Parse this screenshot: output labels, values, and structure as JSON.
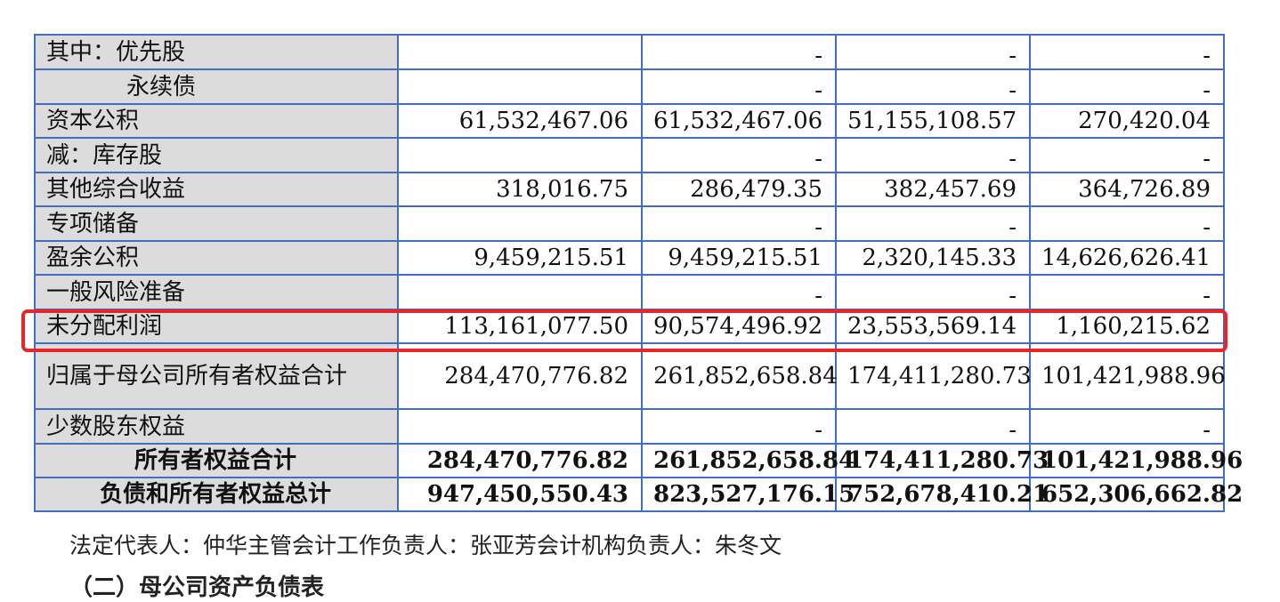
{
  "table": {
    "rows": [
      {
        "label": "其中：优先股",
        "values": [
          "",
          "-",
          "-",
          "-"
        ]
      },
      {
        "label": "永续债",
        "values": [
          "",
          "-",
          "-",
          "-"
        ]
      },
      {
        "label": "资本公积",
        "values": [
          "61,532,467.06",
          "61,532,467.06",
          "51,155,108.57",
          "270,420.04"
        ]
      },
      {
        "label": "减：库存股",
        "values": [
          "",
          "-",
          "-",
          "-"
        ]
      },
      {
        "label": "其他综合收益",
        "values": [
          "318,016.75",
          "286,479.35",
          "382,457.69",
          "364,726.89"
        ]
      },
      {
        "label": "专项储备",
        "values": [
          "",
          "-",
          "-",
          "-"
        ]
      },
      {
        "label": "盈余公积",
        "values": [
          "9,459,215.51",
          "9,459,215.51",
          "2,320,145.33",
          "14,626,626.41"
        ]
      },
      {
        "label": "一般风险准备",
        "values": [
          "",
          "-",
          "-",
          "-"
        ]
      },
      {
        "label": "未分配利润",
        "values": [
          "113,161,077.50",
          "90,574,496.92",
          "23,553,569.14",
          "1,160,215.62"
        ]
      },
      {
        "label": "归属于母公司所有者权益合计",
        "values": [
          "284,470,776.82",
          "261,852,658.84",
          "174,411,280.73",
          "101,421,988.96"
        ]
      },
      {
        "label": "少数股东权益",
        "values": [
          "",
          "-",
          "-",
          "-"
        ]
      },
      {
        "label": "所有者权益合计",
        "values": [
          "284,470,776.82",
          "261,852,658.84",
          "174,411,280.73",
          "101,421,988.96"
        ]
      },
      {
        "label": "负债和所有者权益总计",
        "values": [
          "947,450,550.43",
          "823,527,176.15",
          "752,678,410.21",
          "652,306,662.82"
        ]
      }
    ]
  },
  "highlight_color": "#e8262a",
  "border_color": "#3f6fbd",
  "label_bg": "#dcdcdc",
  "footer": {
    "text": "法定代表人：仲华主管会计工作负责人：张亚芳会计机构负责人：朱冬文"
  },
  "next_heading": {
    "text": "（二）母公司资产负债表"
  }
}
